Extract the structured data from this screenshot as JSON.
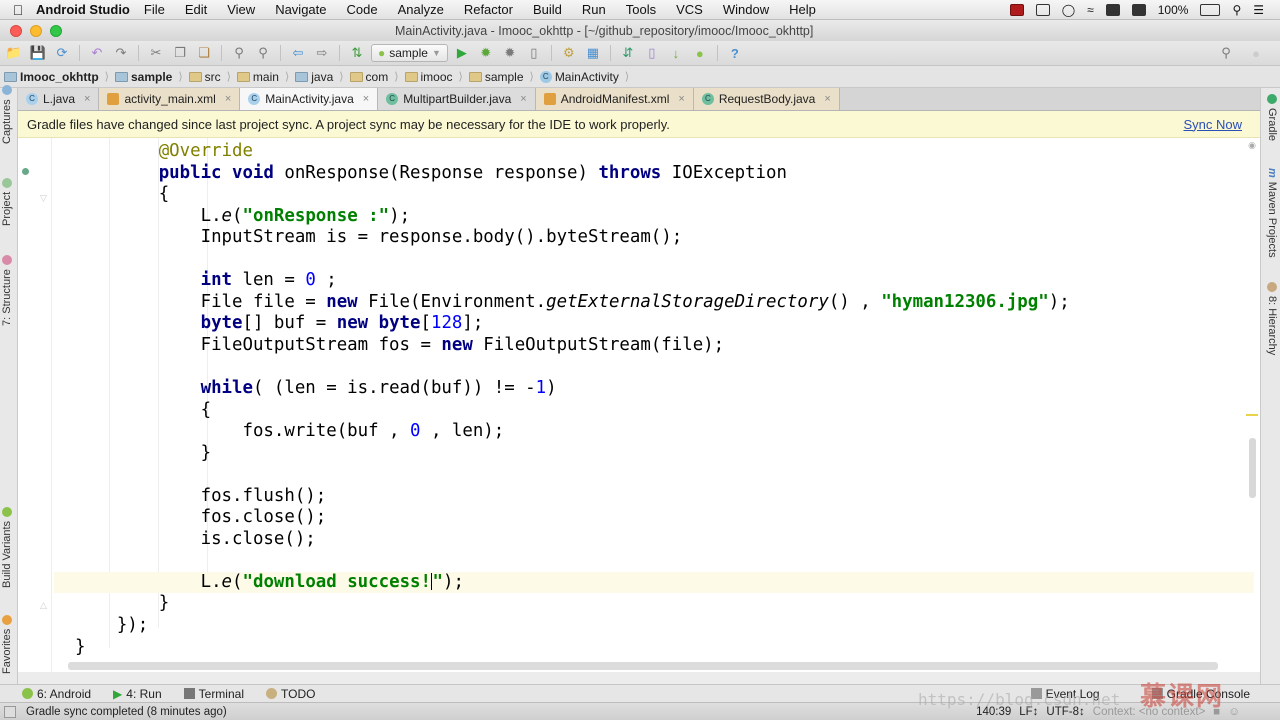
{
  "menubar": {
    "app_name": "Android Studio",
    "items": [
      "File",
      "Edit",
      "View",
      "Navigate",
      "Code",
      "Analyze",
      "Refactor",
      "Build",
      "Run",
      "Tools",
      "VCS",
      "Window",
      "Help"
    ],
    "battery": "100%"
  },
  "window": {
    "title": "MainActivity.java - Imooc_okhttp - [~/github_repository/imooc/Imooc_okhttp]"
  },
  "toolbar": {
    "run_config": "sample",
    "help": "?"
  },
  "breadcrumb": [
    "Imooc_okhttp",
    "sample",
    "src",
    "main",
    "java",
    "com",
    "imooc",
    "sample",
    "MainActivity"
  ],
  "tabs": [
    {
      "label": "L.java",
      "icon": "C",
      "active": false
    },
    {
      "label": "activity_main.xml",
      "icon": "xml",
      "active": false
    },
    {
      "label": "MainActivity.java",
      "icon": "C",
      "active": true
    },
    {
      "label": "MultipartBuilder.java",
      "icon": "class-locked",
      "active": false
    },
    {
      "label": "AndroidManifest.xml",
      "icon": "xml",
      "active": false
    },
    {
      "label": "RequestBody.java",
      "icon": "class-locked",
      "active": false
    }
  ],
  "banner": {
    "message": "Gradle files have changed since last project sync. A project sync may be necessary for the IDE to work properly.",
    "action": "Sync Now"
  },
  "left_tool_windows": [
    "Captures",
    "Project",
    "7: Structure",
    "Build Variants",
    "Favorites"
  ],
  "right_tool_windows": [
    "Gradle",
    "Maven Projects",
    "8: Hierarchy"
  ],
  "code": {
    "l1": "@Override",
    "l2_kw": "public void",
    "l2_rest": " onResponse(Response response) ",
    "l2_throws": "throws",
    "l2_end": " IOException",
    "l3": "{",
    "l4_a": "L.",
    "l4_b": "e",
    "l4_c": "(",
    "l4_str": "\"onResponse :\"",
    "l4_d": ");",
    "l5": "InputStream is = response.body().byteStream();",
    "l7_kw": "int",
    "l7_a": " len = ",
    "l7_num": "0",
    "l7_b": " ;",
    "l8_a": "File file = ",
    "l8_kw": "new",
    "l8_b": " File(Environment.",
    "l8_it": "getExternalStorageDirectory",
    "l8_c": "() , ",
    "l8_str": "\"hyman12306.jpg\"",
    "l8_d": ");",
    "l9_kw1": "byte",
    "l9_a": "[] buf = ",
    "l9_kw2": "new byte",
    "l9_b": "[",
    "l9_num": "128",
    "l9_c": "];",
    "l10_a": "FileOutputStream fos = ",
    "l10_kw": "new",
    "l10_b": " FileOutputStream(file);",
    "l12_kw": "while",
    "l12_a": "( (len = is.read(buf)) != -",
    "l12_num": "1",
    "l12_b": ")",
    "l13": "{",
    "l14_a": "fos.write(buf , ",
    "l14_num": "0",
    "l14_b": " , len);",
    "l15": "}",
    "l17": "fos.flush();",
    "l18": "fos.close();",
    "l19": "is.close();",
    "l21_a": "L.",
    "l21_b": "e",
    "l21_c": "(",
    "l21_str1": "\"download success!",
    "l21_str2": "\"",
    "l21_d": ");",
    "l22": "}",
    "l23": "});",
    "l24": "}"
  },
  "bottom_tools": {
    "android": "6: Android",
    "run": "4: Run",
    "terminal": "Terminal",
    "todo": "TODO",
    "event_log": "Event Log",
    "gradle_console": "Gradle Console"
  },
  "status": {
    "message": "Gradle sync completed (8 minutes ago)",
    "position": "140:39",
    "line_sep": "LF↕",
    "encoding": "UTF-8↕",
    "context": "Context: <no context>"
  },
  "watermark": {
    "text": "慕课网",
    "url": "https://blog.csdn.net"
  }
}
